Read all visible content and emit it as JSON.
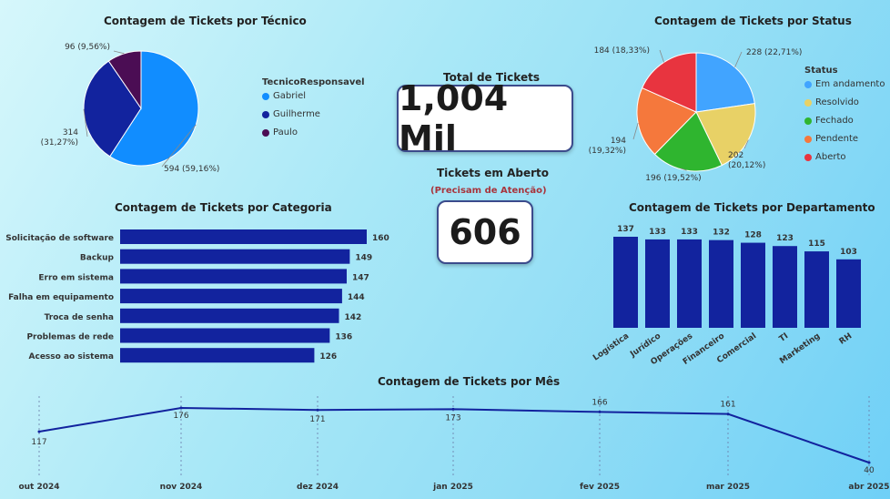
{
  "kpi": {
    "total_title": "Total de Tickets",
    "total_value": "1,004 Mil",
    "open_title": "Tickets em Aberto",
    "open_subtitle": "(Precisam de Atenção)",
    "open_value": "606"
  },
  "chart_data": [
    {
      "id": "tecnico",
      "type": "pie",
      "title": "Contagem de Tickets por Técnico",
      "legend_title": "TecnicoResponsavel",
      "legend_position": "right",
      "slices": [
        {
          "name": "Gabriel",
          "value": 594,
          "label": "594 (59,16%)",
          "color": "#118dff"
        },
        {
          "name": "Guilherme",
          "value": 314,
          "label": "314 (31,27%)",
          "color": "#12239e"
        },
        {
          "name": "Paulo",
          "value": 96,
          "label": "96 (9,56%)",
          "color": "#4b0d54"
        }
      ]
    },
    {
      "id": "status",
      "type": "pie",
      "title": "Contagem de Tickets por Status",
      "legend_title": "Status",
      "legend_position": "right",
      "slices": [
        {
          "name": "Em andamento",
          "value": 228,
          "label": "228 (22,71%)",
          "color": "#41a4ff"
        },
        {
          "name": "Resolvido",
          "value": 202,
          "label": "202 (20,12%)",
          "color": "#e8d166"
        },
        {
          "name": "Fechado",
          "value": 196,
          "label": "196 (19,52%)",
          "color": "#2fb52f"
        },
        {
          "name": "Pendente",
          "value": 194,
          "label": "194 (19,32%)",
          "color": "#f5783c"
        },
        {
          "name": "Aberto",
          "value": 184,
          "label": "184 (18,33%)",
          "color": "#e8343f"
        }
      ]
    },
    {
      "id": "categoria",
      "type": "bar",
      "orientation": "horizontal",
      "title": "Contagem de Tickets por Categoria",
      "categories": [
        "Solicitação de software",
        "Backup",
        "Erro em sistema",
        "Falha em equipamento",
        "Troca de senha",
        "Problemas de rede",
        "Acesso ao sistema"
      ],
      "values": [
        160,
        149,
        147,
        144,
        142,
        136,
        126
      ],
      "color": "#12239e"
    },
    {
      "id": "departamento",
      "type": "bar",
      "orientation": "vertical",
      "title": "Contagem de Tickets por Departamento",
      "categories": [
        "Logística",
        "Jurídico",
        "Operações",
        "Financeiro",
        "Comercial",
        "TI",
        "Marketing",
        "RH"
      ],
      "values": [
        137,
        133,
        133,
        132,
        128,
        123,
        115,
        103
      ],
      "color": "#12239e"
    },
    {
      "id": "mes",
      "type": "line",
      "title": "Contagem de Tickets por Mês",
      "x": [
        "out 2024",
        "nov 2024",
        "dez 2024",
        "jan 2025",
        "fev 2025",
        "mar 2025",
        "abr 2025"
      ],
      "values": [
        117,
        176,
        171,
        173,
        166,
        161,
        40
      ],
      "color": "#12239e"
    }
  ]
}
